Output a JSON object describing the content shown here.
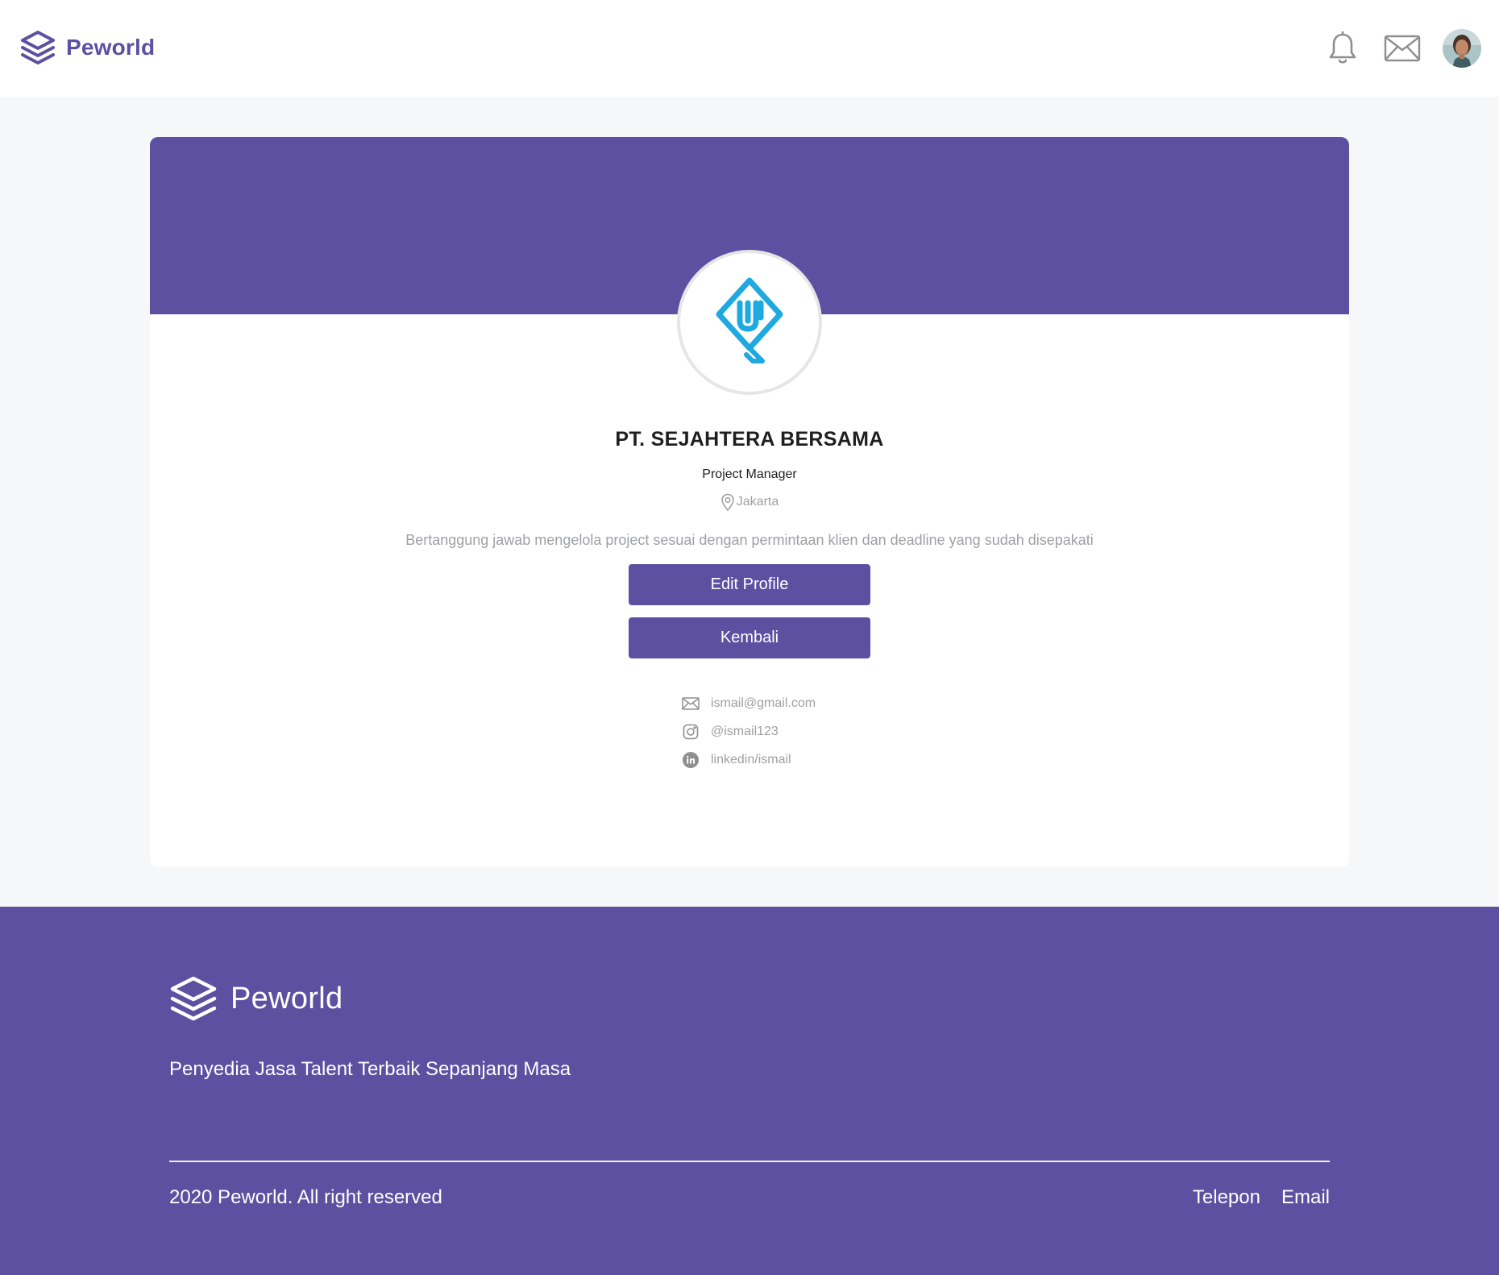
{
  "header": {
    "brand": "Peworld",
    "icons": [
      "bell-icon",
      "mail-icon"
    ],
    "avatar": "user-avatar"
  },
  "company": {
    "name": "PT. SEJAHTERA BERSAMA",
    "field": "Project Manager",
    "location": "Jakarta",
    "description": "Bertanggung jawab mengelola project sesuai dengan permintaan klien dan deadline yang sudah disepakati",
    "logo": "company-logo"
  },
  "actions": {
    "edit_label": "Edit Profile",
    "back_label": "Kembali"
  },
  "contacts": {
    "email": "ismail@gmail.com",
    "instagram": "@ismail123",
    "linkedin": "linkedin/ismail"
  },
  "footer": {
    "brand": "Peworld",
    "tagline": "Penyedia Jasa Talent Terbaik Sepanjang Masa",
    "copyright": "2020 Peworld. All right reserved",
    "links": [
      "Telepon",
      "Email"
    ]
  },
  "colors": {
    "primary": "#5e50a1",
    "muted_text": "#9ea0a5",
    "background": "#f6f7f8",
    "logo_blue": "#1ea9e1"
  }
}
